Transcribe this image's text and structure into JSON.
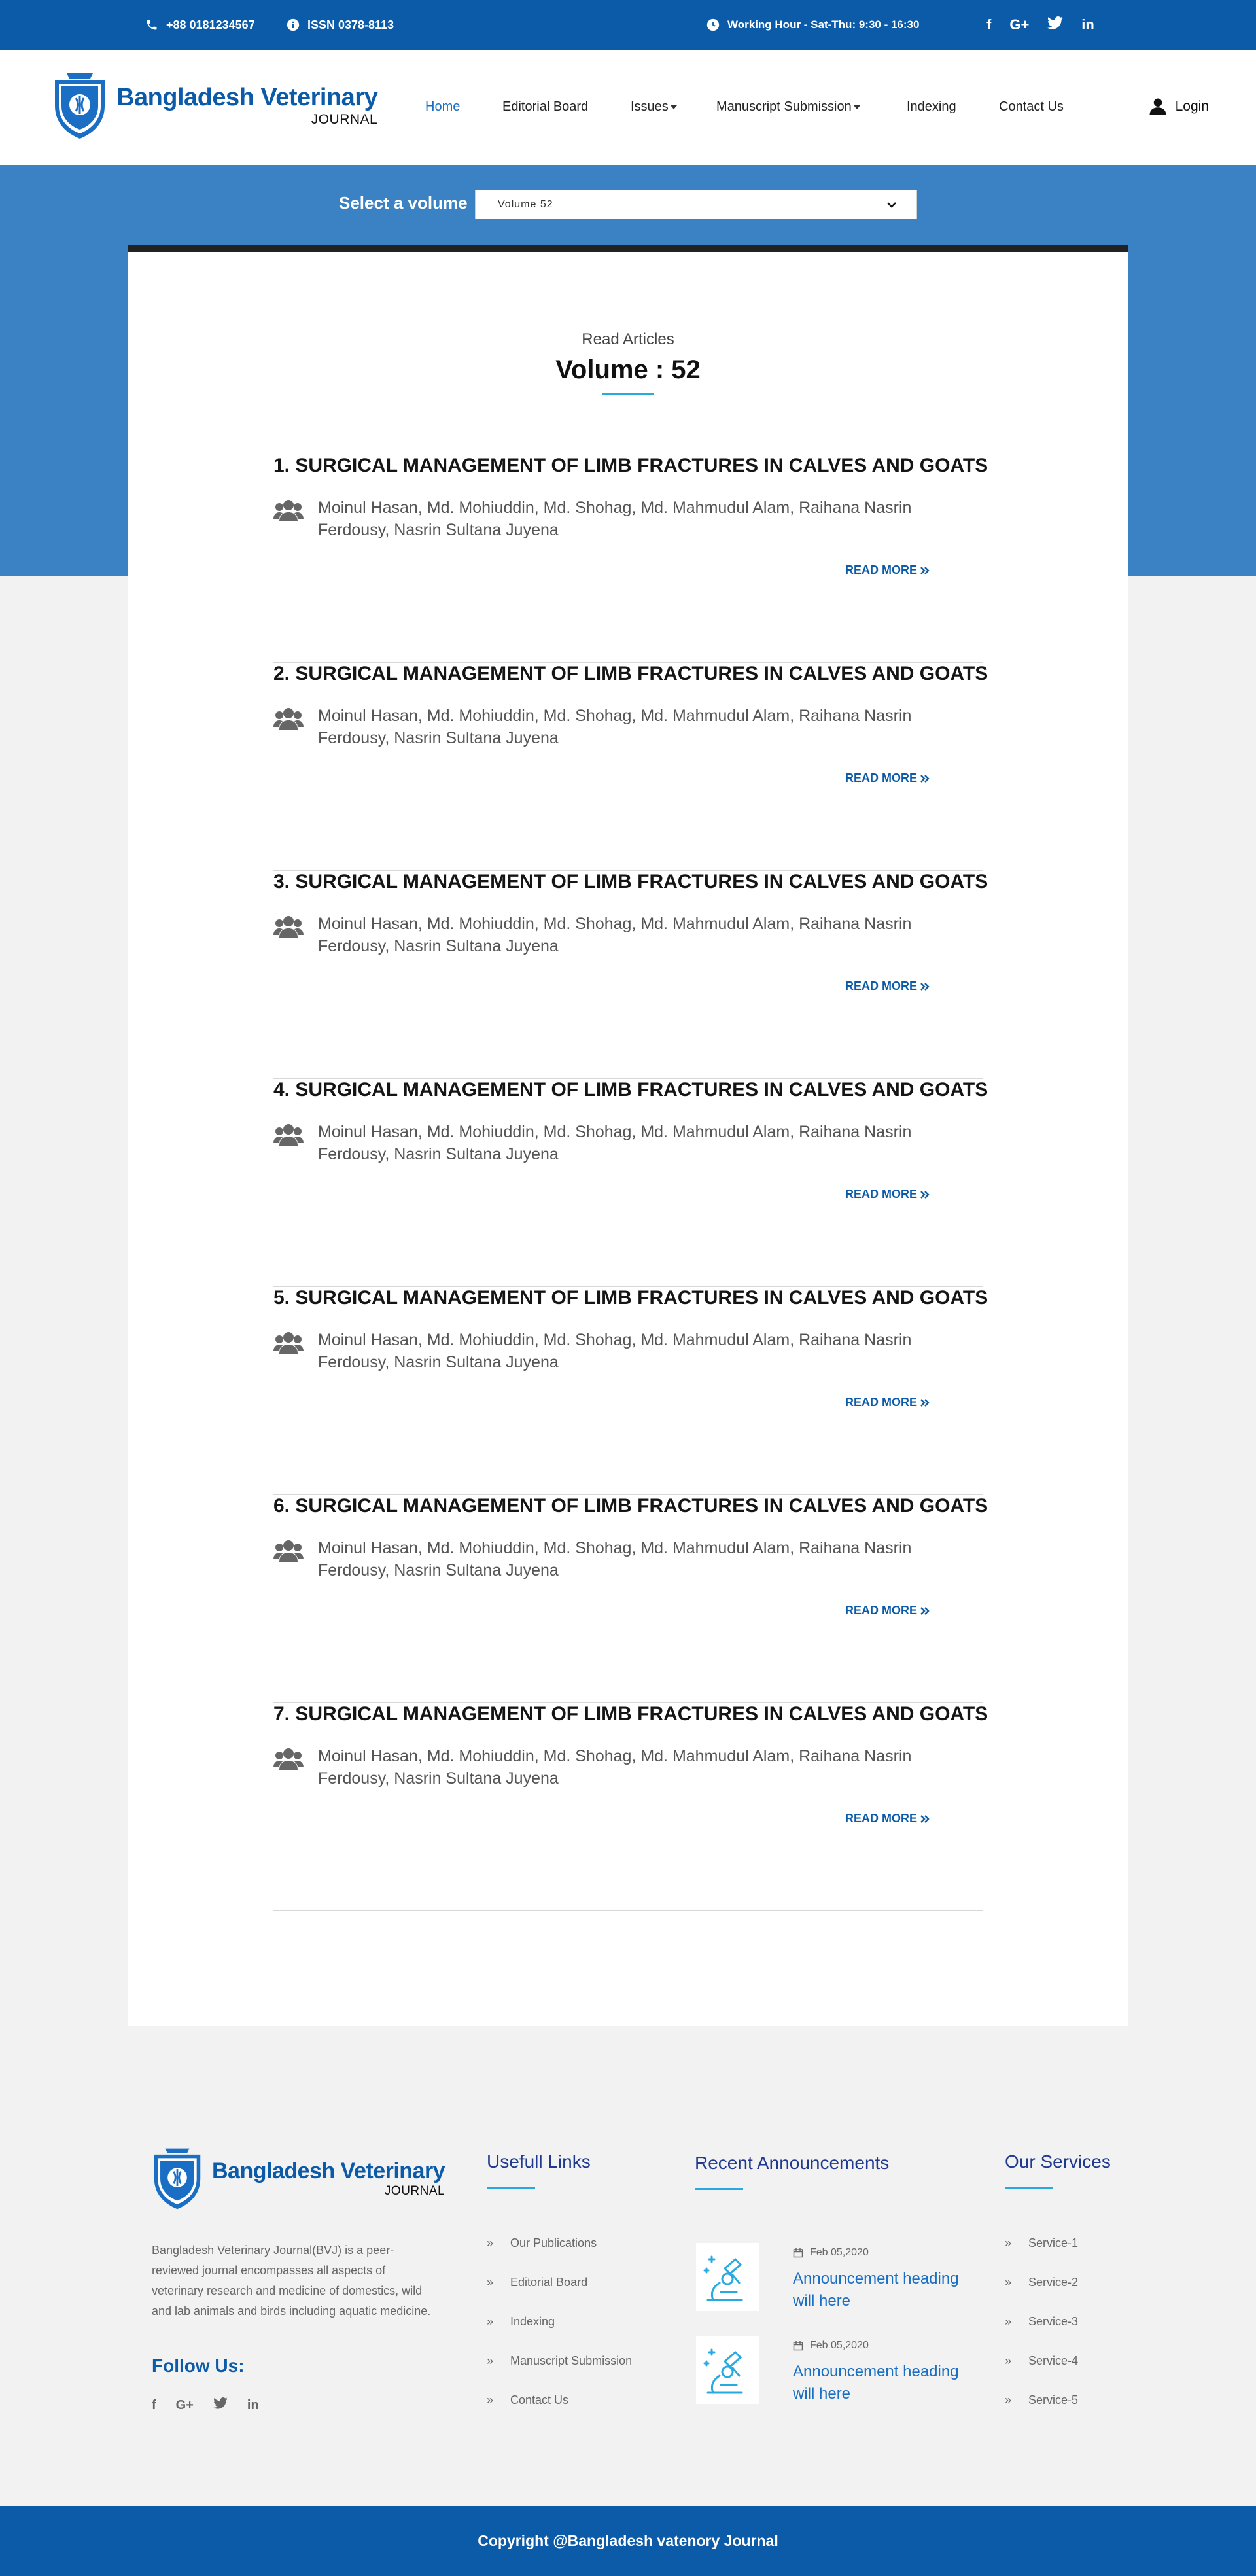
{
  "topbar": {
    "phone": "+88 0181234567",
    "issn": "ISSN 0378-8113",
    "hours": "Working Hour - Sat-Thu: 9:30 - 16:30",
    "social": [
      "f",
      "G+",
      "twitter-icon",
      "in"
    ]
  },
  "header": {
    "logo_title": "Bangladesh Veterinary",
    "logo_sub": "JOURNAL",
    "nav": [
      {
        "label": "Home",
        "active": true
      },
      {
        "label": "Editorial Board"
      },
      {
        "label": "Issues",
        "dropdown": true
      },
      {
        "label": "Manuscript Submission",
        "dropdown": true
      },
      {
        "label": "Indexing"
      },
      {
        "label": "Contact Us"
      }
    ],
    "login": "Login"
  },
  "volume_select": {
    "label": "Select a volume",
    "value": "Volume 52"
  },
  "content": {
    "read_label": "Read Articles",
    "volume_title": "Volume  : 52",
    "read_more": "READ MORE",
    "articles": [
      {
        "title": "1. SURGICAL MANAGEMENT OF LIMB FRACTURES IN CALVES AND GOATS",
        "authors": "Moinul Hasan, Md. Mohiuddin, Md. Shohag, Md. Mahmudul Alam, Raihana Nasrin Ferdousy, Nasrin Sultana Juyena"
      },
      {
        "title": "2. SURGICAL MANAGEMENT OF LIMB FRACTURES IN CALVES AND GOATS",
        "authors": "Moinul Hasan, Md. Mohiuddin, Md. Shohag, Md. Mahmudul Alam, Raihana Nasrin Ferdousy, Nasrin Sultana Juyena"
      },
      {
        "title": "3. SURGICAL MANAGEMENT OF LIMB FRACTURES IN CALVES AND GOATS",
        "authors": "Moinul Hasan, Md. Mohiuddin, Md. Shohag, Md. Mahmudul Alam, Raihana Nasrin Ferdousy, Nasrin Sultana Juyena"
      },
      {
        "title": "4. SURGICAL MANAGEMENT OF LIMB FRACTURES IN CALVES AND GOATS",
        "authors": "Moinul Hasan, Md. Mohiuddin, Md. Shohag, Md. Mahmudul Alam, Raihana Nasrin Ferdousy, Nasrin Sultana Juyena"
      },
      {
        "title": "5. SURGICAL MANAGEMENT OF LIMB FRACTURES IN CALVES AND GOATS",
        "authors": "Moinul Hasan, Md. Mohiuddin, Md. Shohag, Md. Mahmudul Alam, Raihana Nasrin Ferdousy, Nasrin Sultana Juyena"
      },
      {
        "title": "6. SURGICAL MANAGEMENT OF LIMB FRACTURES IN CALVES AND GOATS",
        "authors": "Moinul Hasan, Md. Mohiuddin, Md. Shohag, Md. Mahmudul Alam, Raihana Nasrin Ferdousy, Nasrin Sultana Juyena"
      },
      {
        "title": "7. SURGICAL MANAGEMENT OF LIMB FRACTURES IN CALVES AND GOATS",
        "authors": "Moinul Hasan, Md. Mohiuddin, Md. Shohag, Md. Mahmudul Alam, Raihana Nasrin Ferdousy, Nasrin Sultana Juyena"
      }
    ]
  },
  "footer": {
    "logo_title": "Bangladesh Veterinary",
    "logo_sub": "JOURNAL",
    "about": "Bangladesh Veterinary Journal(BVJ) is a peer-reviewed journal encompasses all aspects of veterinary research and medicine of domestics, wild and lab animals and birds including aquatic medicine.",
    "follow": "Follow Us:",
    "useful_heading": "Usefull Links",
    "useful_links": [
      "Our Publications",
      "Editorial Board",
      "Indexing",
      "Manuscript Submission",
      "Contact Us"
    ],
    "ann_heading": "Recent Announcements",
    "announcements": [
      {
        "date": "Feb 05,2020",
        "heading": "Announcement heading will here"
      },
      {
        "date": "Feb 05,2020",
        "heading": "Announcement heading will here"
      }
    ],
    "services_heading": "Our Services",
    "services": [
      "Service-1",
      "Service-2",
      "Service-3",
      "Service-4",
      "Service-5"
    ],
    "copyright": "Copyright @Bangladesh vatenory Journal"
  },
  "colors": {
    "primary": "#0c5ba9",
    "band": "#3a82c4",
    "accent": "#29a9e1"
  }
}
